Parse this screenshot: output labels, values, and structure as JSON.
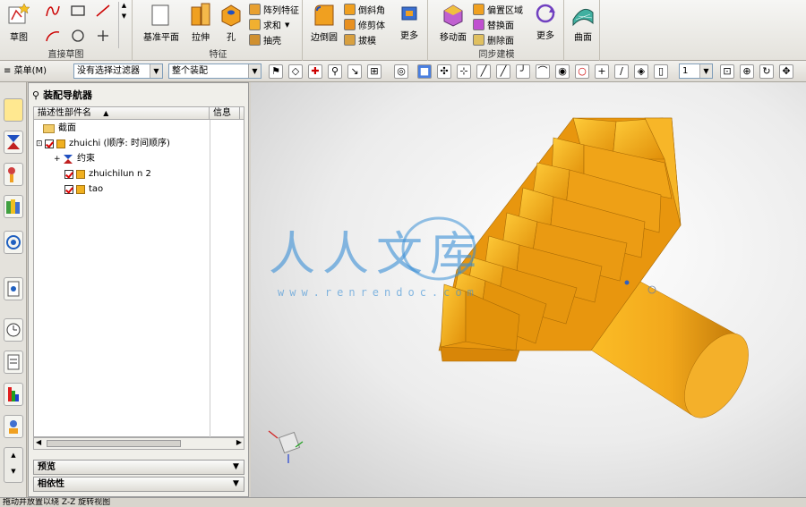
{
  "ribbon": {
    "sketch": {
      "label": "草图"
    },
    "direct_sketch_group": "直接草图",
    "datum_plane": "基准平面",
    "extrude": "拉伸",
    "hole": "孔",
    "pattern_feature": "阵列特征",
    "unite": "求和",
    "shell": "抽壳",
    "feature_group": "特征",
    "edge_blend": "边倒圆",
    "chamfer": "倒斜角",
    "trim_body": "修剪体",
    "draft": "拔模",
    "more_feature": "更多",
    "move_face": "移动面",
    "offset_region": "偏置区域",
    "replace_face": "替换面",
    "delete_face": "删除面",
    "sync_group": "同步建模",
    "more_sync": "更多",
    "surface": "曲面"
  },
  "toolbar": {
    "menu_label": "菜单(M)",
    "filter_value": "没有选择过滤器",
    "scope_value": "整个装配",
    "number_value": "1"
  },
  "navigator": {
    "title": "装配导航器",
    "col_name": "描述性部件名",
    "col_info": "信息",
    "rows": [
      {
        "label": "截面"
      },
      {
        "label": "zhuichi (顺序: 时间顺序)"
      },
      {
        "label": "约束"
      },
      {
        "label": "zhuichilun n 2"
      },
      {
        "label": "tao"
      }
    ]
  },
  "panels": {
    "preview": "预览",
    "dependency": "相依性"
  },
  "status": {
    "text": "拖动并放置以绕 Z-Z 旋转视图"
  },
  "watermark": {
    "text": "人人文库",
    "url": "www.renrendoc.com"
  },
  "colors": {
    "gear_orange": "#f2a81c",
    "gear_dark": "#c97f0a",
    "sleeve": "#b8c4cc",
    "watermark_blue": "#3a8fd6"
  }
}
